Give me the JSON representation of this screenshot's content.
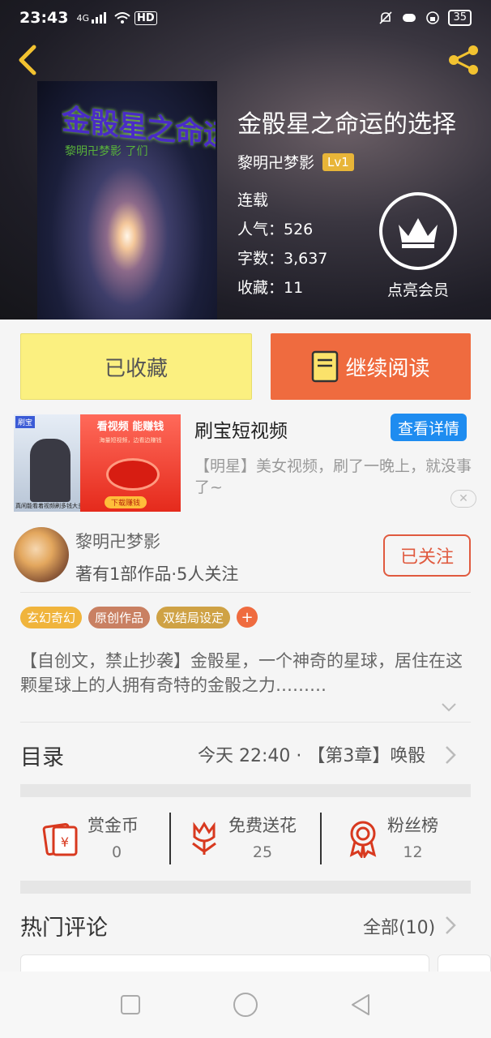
{
  "status_bar": {
    "time": "23:43",
    "network": "4G",
    "hd": "HD",
    "battery": "35"
  },
  "book": {
    "cover_title": "金骰星之命运的选择",
    "cover_subtitle": "黎明卍梦影 了们",
    "title": "金骰星之命运的选择",
    "author": "黎明卍梦影",
    "level": "Lv1",
    "status": "连载",
    "popularity": "人气：526",
    "word_count": "字数：3,637",
    "favorites": "收藏：11",
    "vip_label": "点亮会员"
  },
  "actions": {
    "collected": "已收藏",
    "continue_reading": "继续阅读"
  },
  "ad": {
    "tag": "刷宝",
    "thumb_caption": "真闲能看着视频刷多钱大多",
    "thumb_headline": "看视频 能赚钱",
    "thumb_sub": "海量短视频，边看边赚钱",
    "thumb_download": "下载赚钱",
    "name": "刷宝短视频",
    "detail_button": "查看详情",
    "description": "【明星】美女视频，刷了一晚上，就没事了~",
    "close": "✕"
  },
  "author_section": {
    "name": "黎明卍梦影",
    "info": "著有1部作品·5人关注",
    "follow_button": "已关注"
  },
  "tags": [
    {
      "label": "玄幻奇幻",
      "color": "#f0b43c"
    },
    {
      "label": "原创作品",
      "color": "#c98062"
    },
    {
      "label": "双结局设定",
      "color": "#cfa245"
    }
  ],
  "tag_add": "+",
  "synopsis": "【自创文，禁止抄袭】金骰星，一个神奇的星球，居住在这颗星球上的人拥有奇特的金骰之力………",
  "toc": {
    "title": "目录",
    "latest": "今天 22:40 · 【第3章】唤骰"
  },
  "stats": [
    {
      "label": "赏金币",
      "value": "0",
      "icon": "reward-coin-icon"
    },
    {
      "label": "免费送花",
      "value": "25",
      "icon": "flower-icon"
    },
    {
      "label": "粉丝榜",
      "value": "12",
      "icon": "medal-icon"
    }
  ],
  "comments": {
    "title": "热门评论",
    "all": "全部(10)"
  },
  "colors": {
    "accent": "#ef6b3f",
    "collected_bg": "#fbf080",
    "link_blue": "#1e8cf0",
    "icon_red": "#d8391f"
  }
}
